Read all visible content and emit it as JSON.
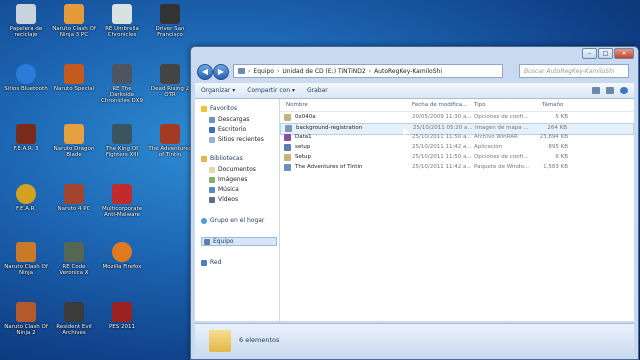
{
  "desktop_icons": [
    {
      "label": "Papelera de reciclaje",
      "icon": "recycle-bin-icon",
      "color": "#c9d3de"
    },
    {
      "label": "Naruto Clash Of Ninja 3 PC",
      "icon": "game-icon",
      "color": "#e59b3a"
    },
    {
      "label": "RE Umbrella Chronicles",
      "icon": "game-icon",
      "color": "#d8e2e2"
    },
    {
      "label": "Driver San Francisco",
      "icon": "game-icon",
      "color": "#333333"
    },
    {
      "label": "Sitios Bluetooth",
      "icon": "bluetooth-icon",
      "color": "#2b7bd8"
    },
    {
      "label": "Naruto Special",
      "icon": "game-icon",
      "color": "#c55a1e"
    },
    {
      "label": "RE The Darkside Chronicles DX9",
      "icon": "game-icon",
      "color": "#4d5560"
    },
    {
      "label": "Dead Rising 2 OTR",
      "icon": "game-icon",
      "color": "#444444"
    },
    {
      "label": "F.E.A.R. 3",
      "icon": "game-icon",
      "color": "#7a2a1a"
    },
    {
      "label": "Naruto Dragon Blade",
      "icon": "game-icon",
      "color": "#e5a140"
    },
    {
      "label": "The King Of Fighters XIII",
      "icon": "game-icon",
      "color": "#3a5560"
    },
    {
      "label": "The Adventures of Tintin",
      "icon": "game-icon",
      "color": "#a33a22"
    },
    {
      "label": "F.E.A.R.",
      "icon": "game-icon",
      "color": "#d4a020"
    },
    {
      "label": "Naruto 4 PC",
      "icon": "game-icon",
      "color": "#a34430"
    },
    {
      "label": "Multicorporate Anti-Malware",
      "icon": "shield-icon",
      "color": "#c22b2b"
    },
    {
      "label": "Naruto Clash Of Ninja",
      "icon": "game-icon",
      "color": "#c77a2a"
    },
    {
      "label": "RE Code Veronica X",
      "icon": "game-icon",
      "color": "#556655"
    },
    {
      "label": "Mozilla Firefox",
      "icon": "firefox-icon",
      "color": "#e07a1f"
    },
    {
      "label": "Naruto Clash Of Ninja 2",
      "icon": "game-icon",
      "color": "#b45a2a"
    },
    {
      "label": "Resident Evil Archives",
      "icon": "game-icon",
      "color": "#3b3b3b"
    },
    {
      "label": "PES 2011",
      "icon": "game-icon",
      "color": "#9a2222"
    }
  ],
  "window": {
    "buttons": {
      "minimize": "–",
      "maximize": "□",
      "close": "✕"
    }
  },
  "address": {
    "crumbs": [
      "Equipo",
      "Unidad de CD (E:) TiNTiND2",
      "AutoRegKey-KamiloShi"
    ],
    "separator": "›"
  },
  "search": {
    "placeholder": "Buscar AutoRegKey-KamiloShi"
  },
  "toolbar": {
    "organize": "Organizar ▾",
    "share": "Compartir con ▾",
    "burn": "Grabar"
  },
  "nav": {
    "favorites": "Favoritos",
    "downloads": "Descargas",
    "desktop": "Escritorio",
    "recent": "Sitios recientes",
    "libraries": "Bibliotecas",
    "documents": "Documentos",
    "images": "Imágenes",
    "music": "Música",
    "videos": "Vídeos",
    "homegroup": "Grupo en el hogar",
    "computer": "Equipo",
    "network": "Red"
  },
  "columns": {
    "name": "Nombre",
    "date": "Fecha de modifica...",
    "type": "Tipo",
    "size": "Tamaño"
  },
  "files": [
    {
      "name": "0x040a",
      "date": "20/05/2009 11:30 a...",
      "type": "Opciones de confi...",
      "size": "5 KB",
      "color": "#c8b37a"
    },
    {
      "name": "background-registration",
      "date": "25/10/2011 05:20 a...",
      "type": "Imagen de mapa ...",
      "size": "264 KB",
      "color": "#7a9ab8"
    },
    {
      "name": "Data1",
      "date": "25/10/2011 11:50 a...",
      "type": "Archivo WinRAR",
      "size": "23,894 KB",
      "color": "#8a4ba8"
    },
    {
      "name": "setup",
      "date": "25/10/2011 11:42 a...",
      "type": "Aplicación",
      "size": "895 KB",
      "color": "#5a7fb5"
    },
    {
      "name": "Setup",
      "date": "25/10/2011 11:50 a...",
      "type": "Opciones de confi...",
      "size": "6 KB",
      "color": "#c8b37a"
    },
    {
      "name": "The Adventures of Tintin",
      "date": "25/10/2011 11:42 a...",
      "type": "Paquete de Windo...",
      "size": "1,583 KB",
      "color": "#6a8fbf"
    }
  ],
  "status": {
    "count": "6 elementos"
  }
}
